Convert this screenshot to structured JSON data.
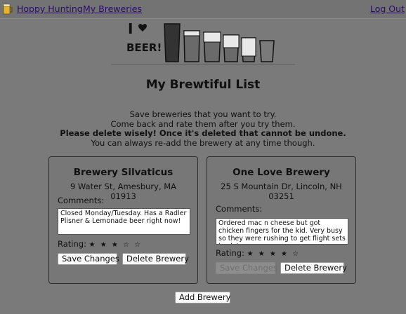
{
  "nav": {
    "logo_icon": "beer-mug-icon",
    "home_label": "Hoppy Hunting",
    "breweries_label": "My Breweries",
    "logout_label": "Log Out"
  },
  "hero": {
    "icon": "beer-glasses-logo",
    "text_i": "I",
    "text_beer": "BEER!"
  },
  "page": {
    "title": "My Brewtiful List",
    "intro": [
      "Save breweries that you want to try.",
      "Come back and rate them after you try them.",
      "Please delete wisely! Once it's deleted that cannot be undone.",
      "You can always re-add the brewery at any time though."
    ],
    "add_label": "Add Brewery"
  },
  "cards": [
    {
      "name": "Brewery Silvaticus",
      "address": "9 Water St, Amesbury, MA 01913",
      "comments_label": "Comments:",
      "comments": "Closed Monday/Tuesday. Has a Radler Plisner & Lemonade beer right now!",
      "rating_label": "Rating:",
      "rating_stars": "★ ★ ★ ☆ ☆",
      "rating": 3,
      "save_label": "Save Changes",
      "delete_label": "Delete Brewery"
    },
    {
      "name": "One Love Brewery",
      "address": "25 S Mountain Dr, Lincoln, NH 03251",
      "comments_label": "Comments:",
      "comments": "Ordered mac n cheese but got chicken fingers for the kid. Very busy so they were rushing to get flight sets back to",
      "rating_label": "Rating:",
      "rating_stars": "★ ★ ★ ★ ☆",
      "rating": 4,
      "save_label": "Save Changes",
      "delete_label": "Delete Brewery"
    }
  ]
}
